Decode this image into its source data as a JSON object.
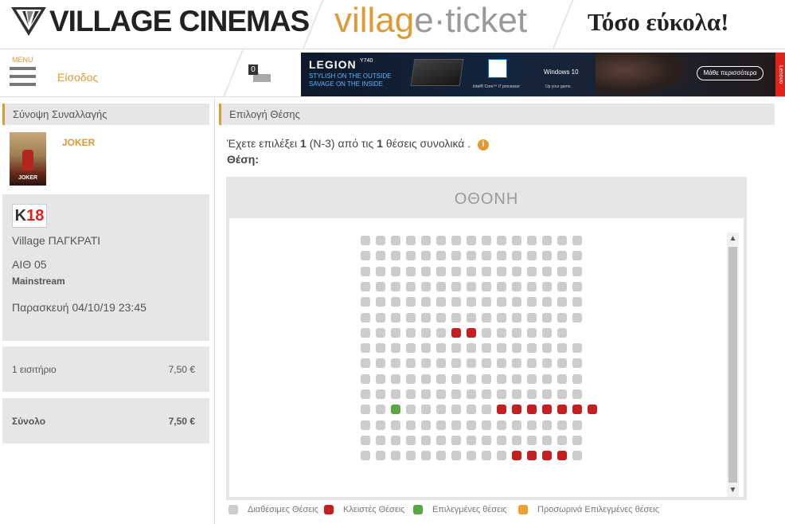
{
  "header": {
    "brand": "VILLAGE CINEMAS",
    "ticket_part1": "villag",
    "ticket_part2": "e",
    "ticket_part3": "ticket",
    "tagline": "Τόσο εύκολα!"
  },
  "nav": {
    "menu_label": "MENU",
    "login": "Είσοδος",
    "cart_count": "0"
  },
  "banner": {
    "brand": "LEGION",
    "model": "Y740",
    "line1": "STYLISH ON THE OUTSIDE",
    "line2": "SAVAGE ON THE INSIDE",
    "intel_text": "Intel® Core™ i7 processor",
    "windows": "Windows 10",
    "windows_sub": "Up your game.",
    "button": "Μάθε περισσότερα",
    "lenovo": "Lenovo"
  },
  "summary": {
    "title": "Σύνοψη Συναλλαγής",
    "movie_title": "JOKER",
    "poster_text": "JOKER",
    "rating_letter": "K",
    "rating_age": "18",
    "cinema": "Village ΠΑΓΚΡΑΤΙ",
    "hall": "ΑΙΘ 05",
    "type": "Mainstream",
    "datetime": "Παρασκευή 04/10/19 23:45",
    "tickets_label": "1 εισιτήριο",
    "tickets_price": "7,50 €",
    "total_label": "Σύνολο",
    "total_price": "7,50 €"
  },
  "seat_selection": {
    "title": "Επιλογή Θέσης",
    "msg_pre": "Έχετε επιλέξει",
    "msg_count": "1",
    "msg_seat": "(N-3)",
    "msg_mid": "από τις",
    "msg_total": "1",
    "msg_post": "θέσεις συνολικά .",
    "info_icon": "i",
    "seat_label": "Θέση:",
    "screen_label": "ΟΘΟΝΗ",
    "scroll_up": "▲",
    "scroll_down": "▼"
  },
  "legend": {
    "available": "Διαθέσιμες Θέσεις",
    "closed": "Κλειστές Θέσεις",
    "selected": "Επιλεγμένες θέσεις",
    "temporary": "Προσωρινά Επιλεγμένες θέσεις"
  },
  "colors": {
    "accent": "#e09a35",
    "available": "#cccccc",
    "closed": "#c41e1e",
    "selected": "#5aa845",
    "temporary": "#f0a030"
  },
  "seat_rows": [
    "aaaaaaaaaaaaaaa",
    "aaaaaaaaaaaaaaa",
    "aaaaaaaaaaaaaaa",
    "aaaaaaaaaaaaaaa",
    "aaaaaaaaaaaaaaa",
    "aaaaaaaaaaaaaaa",
    "aaaaaaccaaaaaa",
    "aaaaaaaaaaaaaaa",
    "aaaaaaaaaaaaaaa",
    "aaaaaaaaaaaaaaa",
    "aaaaaaaaaaaaaaa",
    "aasaaaaaaccccccc",
    "aaaaaaaaaaaaaaa",
    "aaaaaaaaaaaaaaa",
    "aaaaaaaaaacccca"
  ]
}
